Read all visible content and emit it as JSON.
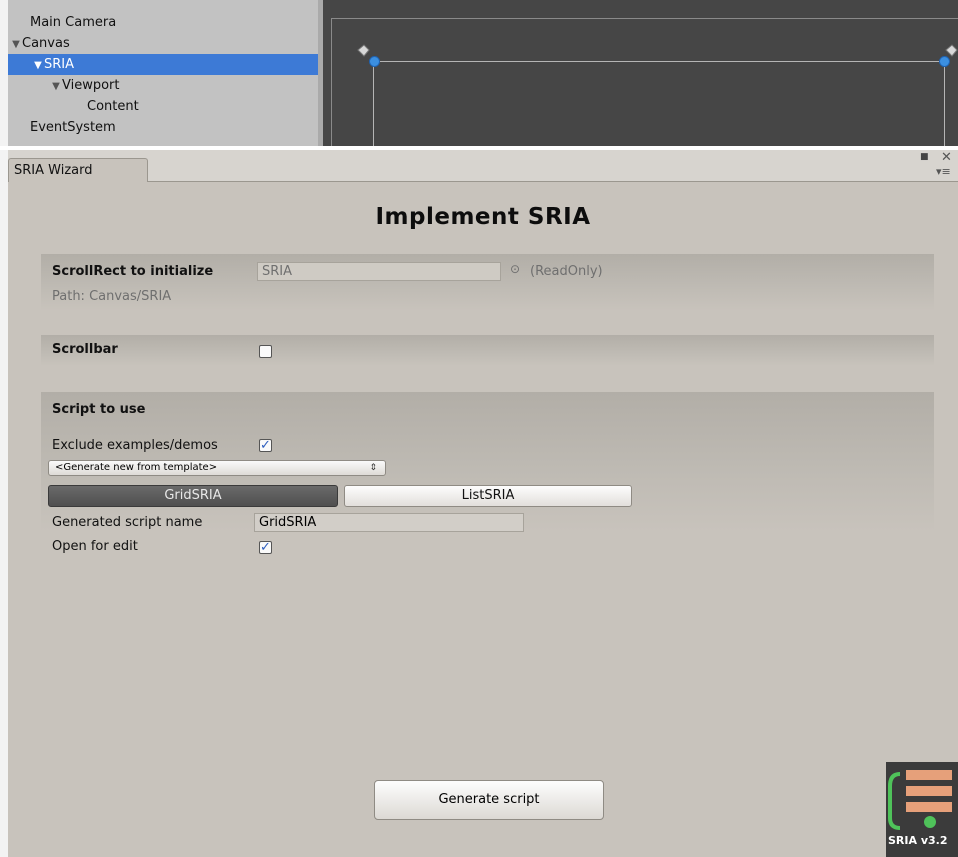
{
  "hierarchy": {
    "items": [
      {
        "label": "Main Camera"
      },
      {
        "label": "Canvas"
      },
      {
        "label": "SRIA"
      },
      {
        "label": "Viewport"
      },
      {
        "label": "Content"
      },
      {
        "label": "EventSystem"
      }
    ]
  },
  "window": {
    "tab_label": "SRIA Wizard",
    "icons": [
      "maximize-icon",
      "close-icon",
      "menu-icon"
    ]
  },
  "main": {
    "title": "Implement SRIA"
  },
  "scrollrect_section": {
    "label": "ScrollRect to initialize",
    "field_value": "SRIA",
    "readonly_note": "(ReadOnly)",
    "path_text": "Path: Canvas/SRIA"
  },
  "scrollbar_section": {
    "label": "Scrollbar",
    "checked": false
  },
  "script_section": {
    "title": "Script to use",
    "exclude_label": "Exclude examples/demos",
    "exclude_checked": true,
    "dropdown_value": "<Generate new from template>",
    "template_buttons": [
      {
        "label": "GridSRIA",
        "selected": true
      },
      {
        "label": "ListSRIA",
        "selected": false
      }
    ],
    "script_name_label": "Generated script name",
    "script_name_value": "GridSRIA",
    "open_edit_label": "Open for edit",
    "open_edit_checked": true
  },
  "footer": {
    "generate_label": "Generate script",
    "logo_text": "SRIA v3.2"
  },
  "colors": {
    "selection": "#3d7ad6",
    "panel": "#c8c3bc",
    "check": "#2f5fbf"
  }
}
